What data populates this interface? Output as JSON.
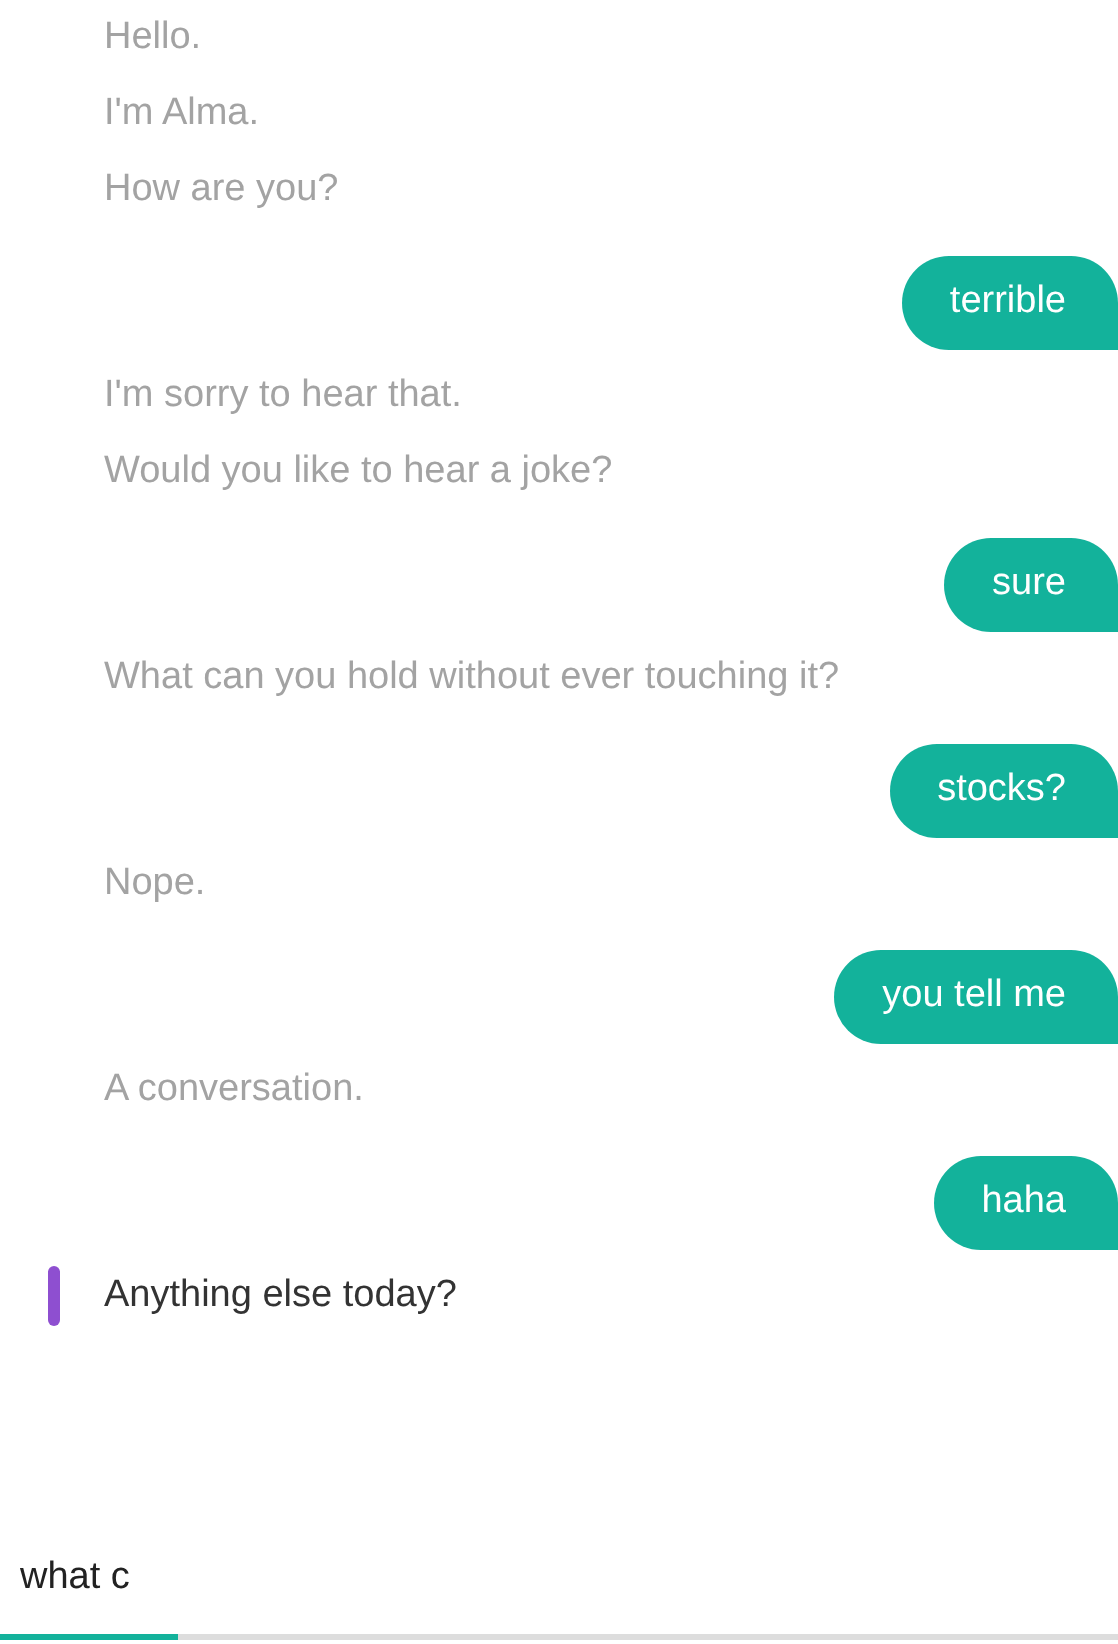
{
  "messages": [
    {
      "kind": "bot",
      "text": "Hello.",
      "active": false
    },
    {
      "kind": "bot",
      "text": "I'm Alma.",
      "active": false
    },
    {
      "kind": "bot",
      "text": "How are you?",
      "active": false
    },
    {
      "kind": "user",
      "text": "terrible"
    },
    {
      "kind": "bot",
      "text": "I'm sorry to hear that.",
      "active": false
    },
    {
      "kind": "bot",
      "text": "Would you like to hear a joke?",
      "active": false
    },
    {
      "kind": "user",
      "text": "sure"
    },
    {
      "kind": "bot",
      "text": "What can you hold without ever touching it?",
      "active": false
    },
    {
      "kind": "user",
      "text": "stocks?"
    },
    {
      "kind": "bot",
      "text": "Nope.",
      "active": false
    },
    {
      "kind": "user",
      "text": "you tell me"
    },
    {
      "kind": "bot",
      "text": "A conversation.",
      "active": false
    },
    {
      "kind": "user",
      "text": "haha"
    },
    {
      "kind": "bot",
      "text": "Anything else today?",
      "active": true
    }
  ],
  "input": {
    "value": "what c",
    "level": 0.16
  }
}
